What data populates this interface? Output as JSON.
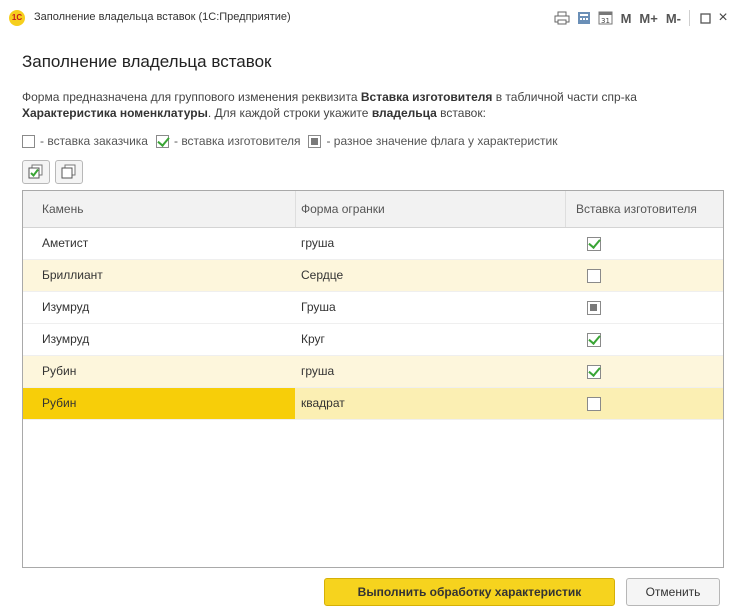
{
  "window": {
    "logo_text": "1С",
    "title": "Заполнение владельца вставок  (1С:Предприятие)",
    "icons": [
      "print-icon",
      "calculator-icon",
      "calendar-icon",
      "memory-m",
      "memory-m-plus",
      "memory-m-minus",
      "maximize-icon",
      "close-icon"
    ],
    "m_label": "M",
    "mplus_label": "M+",
    "mminus_label": "M-",
    "calendar_day": "31",
    "close_glyph": "×"
  },
  "form": {
    "title": "Заполнение владельца вставок",
    "description": {
      "part1": "Форма предназначена для группового изменения реквизита ",
      "bold1": "Вставка изготовителя",
      "part2": " в табличной части спр-ка ",
      "bold2": "Характеристика номенклатуры",
      "part3": ". Для каждой строки укажите ",
      "bold3": "владельца",
      "part4": " вставок:"
    },
    "legend": {
      "customer": "- вставка заказчика",
      "manufacturer": "- вставка изготовителя",
      "mixed": "- разное значение флага у характеристик"
    }
  },
  "toolbar": {
    "check_all_icon": "check-all-icon",
    "uncheck_all_icon": "uncheck-all-icon"
  },
  "table": {
    "columns": [
      "Камень",
      "Форма огранки",
      "Вставка изготовителя"
    ],
    "rows": [
      {
        "stone": "Аметист",
        "cut": "груша",
        "flag": "checked",
        "style": "normal"
      },
      {
        "stone": "Бриллиант",
        "cut": "Сердце",
        "flag": "unchecked",
        "style": "alt"
      },
      {
        "stone": "Изумруд",
        "cut": "Груша",
        "flag": "mixed",
        "style": "normal"
      },
      {
        "stone": "Изумруд",
        "cut": "Круг",
        "flag": "checked",
        "style": "normal"
      },
      {
        "stone": "Рубин",
        "cut": "груша",
        "flag": "checked",
        "style": "alt"
      },
      {
        "stone": "Рубин",
        "cut": "квадрат",
        "flag": "unchecked",
        "style": "selected"
      }
    ]
  },
  "buttons": {
    "run": "Выполнить обработку характеристик",
    "cancel": "Отменить"
  },
  "colors": {
    "accent_yellow": "#f6d31e",
    "selected_cell": "#f7ce09",
    "alt_row": "#fdf6dc",
    "check_green": "#3aa535"
  }
}
